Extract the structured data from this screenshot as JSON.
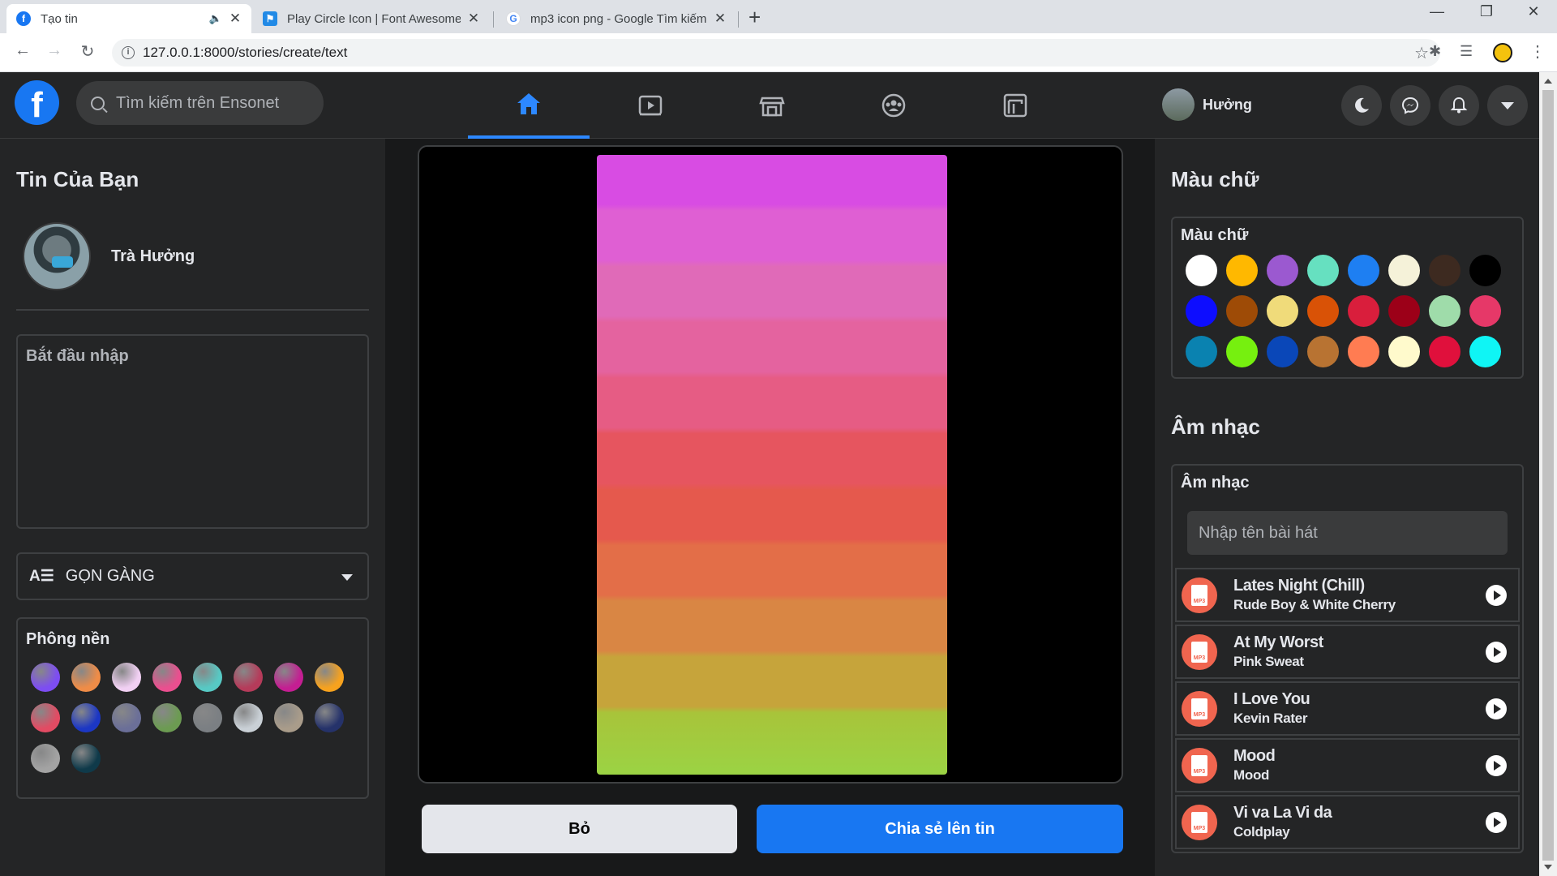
{
  "browser": {
    "tabs": [
      {
        "title": "Tạo tin",
        "icon": "facebook-icon"
      },
      {
        "title": "Play Circle Icon | Font Awesome",
        "icon": "font-awesome-flag-icon"
      },
      {
        "title": "mp3 icon png - Google Tìm kiếm",
        "icon": "google-icon"
      }
    ],
    "url": "127.0.0.1:8000/stories/create/text"
  },
  "header": {
    "search_placeholder": "Tìm kiếm trên Ensonet",
    "user_name": "Hưởng",
    "active_tab": "home"
  },
  "left": {
    "title": "Tin Của Bạn",
    "user_name": "Trà Hưởng",
    "text_placeholder": "Bắt đầu nhập",
    "font_label": "GỌN GÀNG",
    "bg_title": "Phông nền",
    "backgrounds": [
      "#7d4df2",
      "#ef8c47",
      "#f1d0f3",
      "#ea4f8f",
      "#57c9c4",
      "#b53b5a",
      "#c41e92",
      "#f7a21e",
      "#e24b63",
      "#1c37c4",
      "#6b6f98",
      "#6c9b52",
      "#7b7f83",
      "#c9d0d6",
      "#a99c8a",
      "#25326a",
      "#a3a3a3",
      "#0f3a4a"
    ]
  },
  "center": {
    "cancel_label": "Bỏ",
    "share_label": "Chia sẻ lên tin"
  },
  "right": {
    "text_color_title": "Màu chữ",
    "text_color_panel_title": "Màu chữ",
    "text_colors": [
      "#ffffff",
      "#ffb800",
      "#9b59d0",
      "#66e0c0",
      "#1e7ff2",
      "#f5f2d9",
      "#3d2a20",
      "#000000",
      "#0d0dff",
      "#9e4b06",
      "#f0db7a",
      "#d95206",
      "#d91e3c",
      "#9c0018",
      "#9fdcaa",
      "#e63868",
      "#0a82b0",
      "#76f00f",
      "#0a47b8",
      "#b87332",
      "#ff7c52",
      "#fffacc",
      "#e0103c",
      "#0ff5f5"
    ],
    "music_title": "Âm nhạc",
    "music_panel_title": "Âm nhạc",
    "song_placeholder": "Nhập tên bài hát",
    "songs": [
      {
        "title": "Lates Night (Chill)",
        "artist": "Rude Boy & White Cherry"
      },
      {
        "title": "At My Worst",
        "artist": "Pink Sweat"
      },
      {
        "title": "I Love You",
        "artist": "Kevin Rater"
      },
      {
        "title": "Mood",
        "artist": "Mood"
      },
      {
        "title": "Vi va La Vi da",
        "artist": "Coldplay"
      }
    ]
  }
}
